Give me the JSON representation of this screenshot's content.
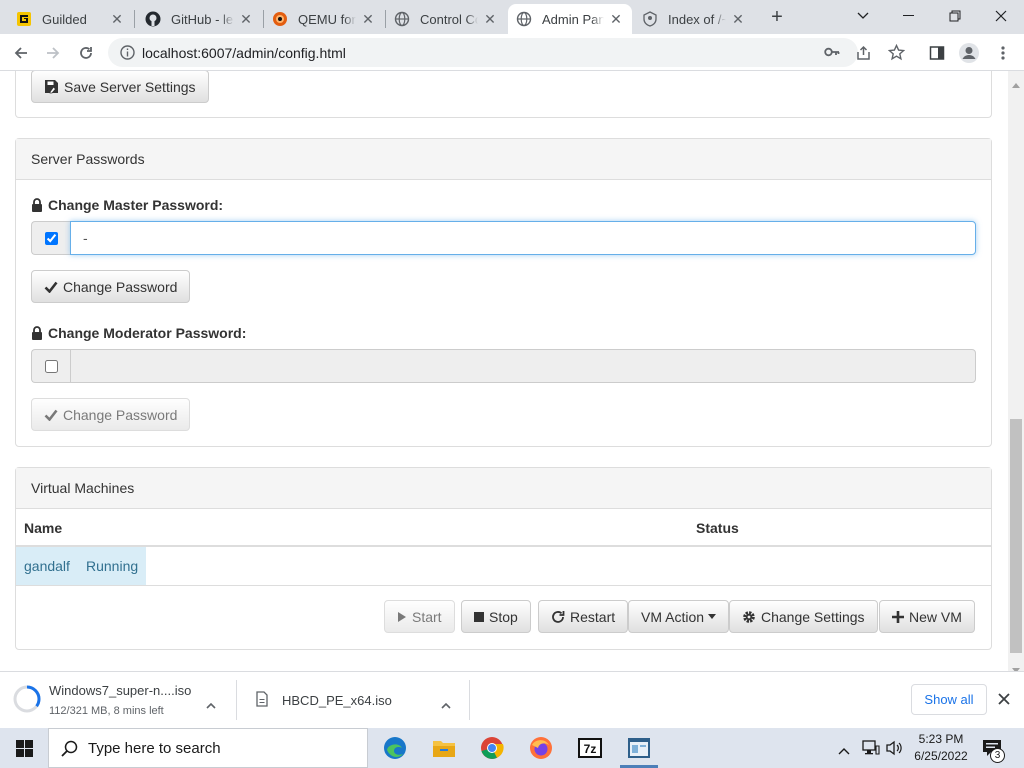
{
  "tabs": [
    {
      "title": "Guilded",
      "icon": "guilded-icon"
    },
    {
      "title": "GitHub - le",
      "icon": "github-icon"
    },
    {
      "title": "QEMU for W",
      "icon": "qemu-icon"
    },
    {
      "title": "Control Co",
      "icon": "globe-icon"
    },
    {
      "title": "Admin Pan",
      "icon": "globe-icon"
    },
    {
      "title": "Index of /~",
      "icon": "index-icon"
    }
  ],
  "active_tab": "Admin Pan",
  "address": "localhost:6007/admin/config.html",
  "save_server_settings": "Save Server Settings",
  "passwords": {
    "heading": "Server Passwords",
    "master_label": "Change Master Password:",
    "master_value": "-",
    "master_checked": true,
    "master_button": "Change Password",
    "moderator_label": "Change Moderator Password:",
    "moderator_value": "",
    "moderator_checked": false,
    "moderator_button": "Change Password"
  },
  "vms": {
    "heading": "Virtual Machines",
    "columns": [
      "Name",
      "Status"
    ],
    "rows": [
      {
        "name": "gandalf",
        "status": "Running"
      }
    ],
    "actions": {
      "start": "Start",
      "stop": "Stop",
      "restart": "Restart",
      "vm_action": "VM Action",
      "change_settings": "Change Settings",
      "new_vm": "New VM"
    }
  },
  "downloads": [
    {
      "name": "Windows7_super-n....iso",
      "status": "112/321 MB, 8 mins left",
      "progress": 0.35
    },
    {
      "name": "HBCD_PE_x64.iso",
      "status": ""
    }
  ],
  "show_all": "Show all",
  "taskbar": {
    "search_placeholder": "Type here to search",
    "time": "5:23 PM",
    "date": "6/25/2022",
    "notifications": "3"
  },
  "colors": {
    "accent_focus": "#66afe9",
    "active_row": "#d9edf7",
    "chrome_bg": "#dee1e6"
  }
}
